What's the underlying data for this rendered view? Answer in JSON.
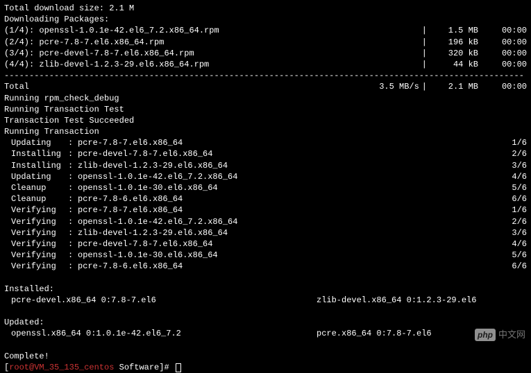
{
  "header": {
    "total_download_size": "Total download size: 2.1 M",
    "downloading": "Downloading Packages:"
  },
  "downloads": [
    {
      "name": "(1/4): openssl-1.0.1e-42.el6_7.2.x86_64.rpm",
      "size": "1.5 MB",
      "time": "00:00"
    },
    {
      "name": "(2/4): pcre-7.8-7.el6.x86_64.rpm",
      "size": "196 kB",
      "time": "00:00"
    },
    {
      "name": "(3/4): pcre-devel-7.8-7.el6.x86_64.rpm",
      "size": "320 kB",
      "time": "00:00"
    },
    {
      "name": "(4/4): zlib-devel-1.2.3-29.el6.x86_64.rpm",
      "size": "44 kB",
      "time": "00:00"
    }
  ],
  "divider": "--------------------------------------------------------------------------------------------------------",
  "total_row": {
    "label": "Total",
    "speed": "3.5 MB/s",
    "size": "2.1 MB",
    "time": "00:00"
  },
  "msgs": {
    "rpm_check": "Running rpm_check_debug",
    "txn_test": "Running Transaction Test",
    "txn_succ": "Transaction Test Succeeded",
    "running_txn": "Running Transaction"
  },
  "txn": [
    {
      "action": "Updating",
      "pkg": "pcre-7.8-7.el6.x86_64",
      "count": "1/6"
    },
    {
      "action": "Installing",
      "pkg": "pcre-devel-7.8-7.el6.x86_64",
      "count": "2/6"
    },
    {
      "action": "Installing",
      "pkg": "zlib-devel-1.2.3-29.el6.x86_64",
      "count": "3/6"
    },
    {
      "action": "Updating",
      "pkg": "openssl-1.0.1e-42.el6_7.2.x86_64",
      "count": "4/6"
    },
    {
      "action": "Cleanup",
      "pkg": "openssl-1.0.1e-30.el6.x86_64",
      "count": "5/6"
    },
    {
      "action": "Cleanup",
      "pkg": "pcre-7.8-6.el6.x86_64",
      "count": "6/6"
    },
    {
      "action": "Verifying",
      "pkg": "pcre-7.8-7.el6.x86_64",
      "count": "1/6"
    },
    {
      "action": "Verifying",
      "pkg": "openssl-1.0.1e-42.el6_7.2.x86_64",
      "count": "2/6"
    },
    {
      "action": "Verifying",
      "pkg": "zlib-devel-1.2.3-29.el6.x86_64",
      "count": "3/6"
    },
    {
      "action": "Verifying",
      "pkg": "pcre-devel-7.8-7.el6.x86_64",
      "count": "4/6"
    },
    {
      "action": "Verifying",
      "pkg": "openssl-1.0.1e-30.el6.x86_64",
      "count": "5/6"
    },
    {
      "action": "Verifying",
      "pkg": "pcre-7.8-6.el6.x86_64",
      "count": "6/6"
    }
  ],
  "installed": {
    "header": "Installed:",
    "a": "pcre-devel.x86_64 0:7.8-7.el6",
    "b": "zlib-devel.x86_64 0:1.2.3-29.el6"
  },
  "updated": {
    "header": "Updated:",
    "a": "openssl.x86_64 0:1.0.1e-42.el6_7.2",
    "b": "pcre.x86_64 0:7.8-7.el6"
  },
  "complete": "Complete!",
  "prompt": {
    "bracket_open": "[",
    "user": "root@VM_35_135_centos ",
    "path": "Software",
    "bracket_close": "]# "
  },
  "watermark": {
    "logo": "php",
    "text": "中文网"
  }
}
